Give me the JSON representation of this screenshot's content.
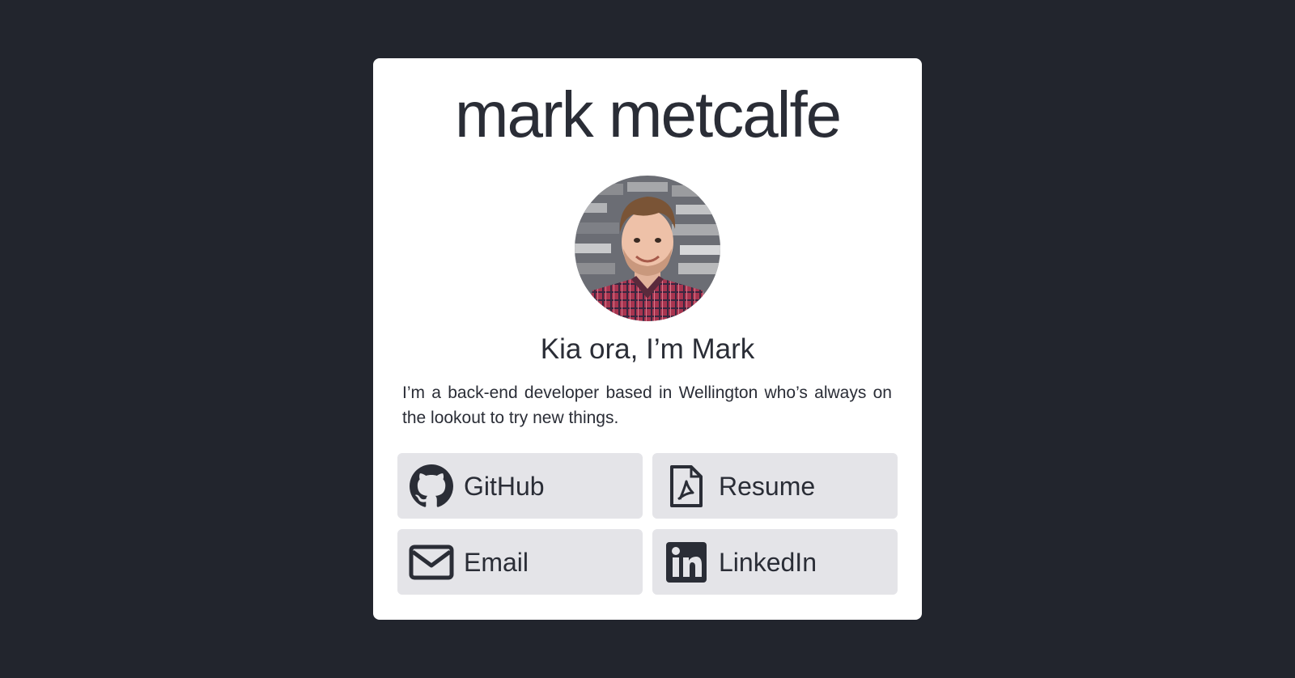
{
  "theme": {
    "background": "#22252d",
    "card_bg": "#ffffff",
    "text": "#2a2d36",
    "button_bg": "#e4e4e8",
    "icon": "#2a2d36"
  },
  "profile": {
    "name": "mark metcalfe",
    "greeting": "Kia ora, I’m Mark",
    "bio": "I’m a back-end developer based in Wellington who’s always on the lookout to try new things."
  },
  "links": [
    {
      "label": "GitHub",
      "icon": "github-icon"
    },
    {
      "label": "Resume",
      "icon": "pdf-file-icon"
    },
    {
      "label": "Email",
      "icon": "envelope-icon"
    },
    {
      "label": "LinkedIn",
      "icon": "linkedin-icon"
    }
  ]
}
